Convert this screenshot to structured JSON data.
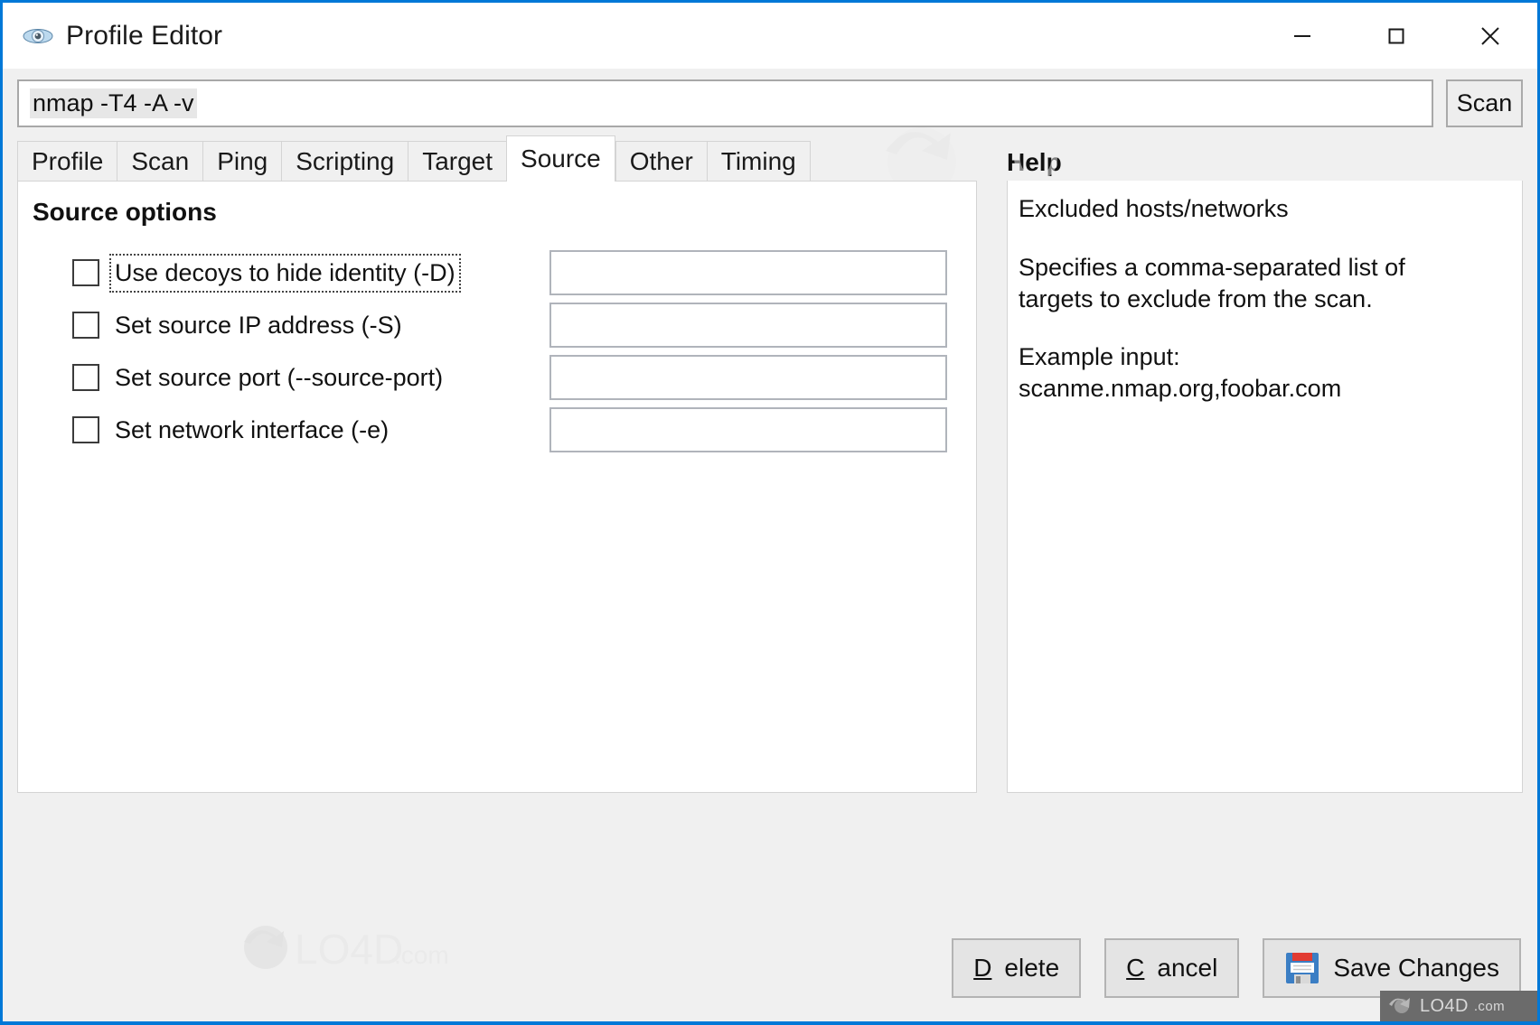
{
  "window": {
    "title": "Profile Editor",
    "icon": "zenmap-eye-icon",
    "accent_color": "#0078d7",
    "controls": [
      {
        "name": "minimize",
        "glyph": "minimize-icon"
      },
      {
        "name": "maximize",
        "glyph": "maximize-icon"
      },
      {
        "name": "close",
        "glyph": "close-icon"
      }
    ]
  },
  "command_bar": {
    "value": "nmap -T4 -A -v",
    "placeholder": "",
    "scan_label": "Scan"
  },
  "tabs": [
    {
      "label": "Profile",
      "active": false
    },
    {
      "label": "Scan",
      "active": false
    },
    {
      "label": "Ping",
      "active": false
    },
    {
      "label": "Scripting",
      "active": false
    },
    {
      "label": "Target",
      "active": false
    },
    {
      "label": "Source",
      "active": true
    },
    {
      "label": "Other",
      "active": false
    },
    {
      "label": "Timing",
      "active": false
    }
  ],
  "panel": {
    "group_title": "Source options",
    "options": [
      {
        "label": "Use decoys to hide identity (-D)",
        "checked": false,
        "focused": true,
        "value": ""
      },
      {
        "label": "Set source IP address (-S)",
        "checked": false,
        "focused": false,
        "value": ""
      },
      {
        "label": "Set source port (--source-port)",
        "checked": false,
        "focused": false,
        "value": ""
      },
      {
        "label": "Set network interface (-e)",
        "checked": false,
        "focused": false,
        "value": ""
      }
    ]
  },
  "help": {
    "title": "Help",
    "heading": "Excluded hosts/networks",
    "body_line_1": "Specifies a comma-separated list of",
    "body_line_2": "targets to exclude from the scan.",
    "example_label": "Example input:",
    "example_value": "scanme.nmap.org,foobar.com"
  },
  "footer": {
    "delete": {
      "accel": "D",
      "rest": "elete"
    },
    "cancel": {
      "accel": "C",
      "rest": "ancel"
    },
    "save": {
      "label": "Save Changes",
      "icon": "floppy-disk-icon"
    }
  },
  "watermark": {
    "text": "LO4D",
    "suffix": ".com",
    "badge_text": "LO4D",
    "badge_suffix": ".com"
  }
}
